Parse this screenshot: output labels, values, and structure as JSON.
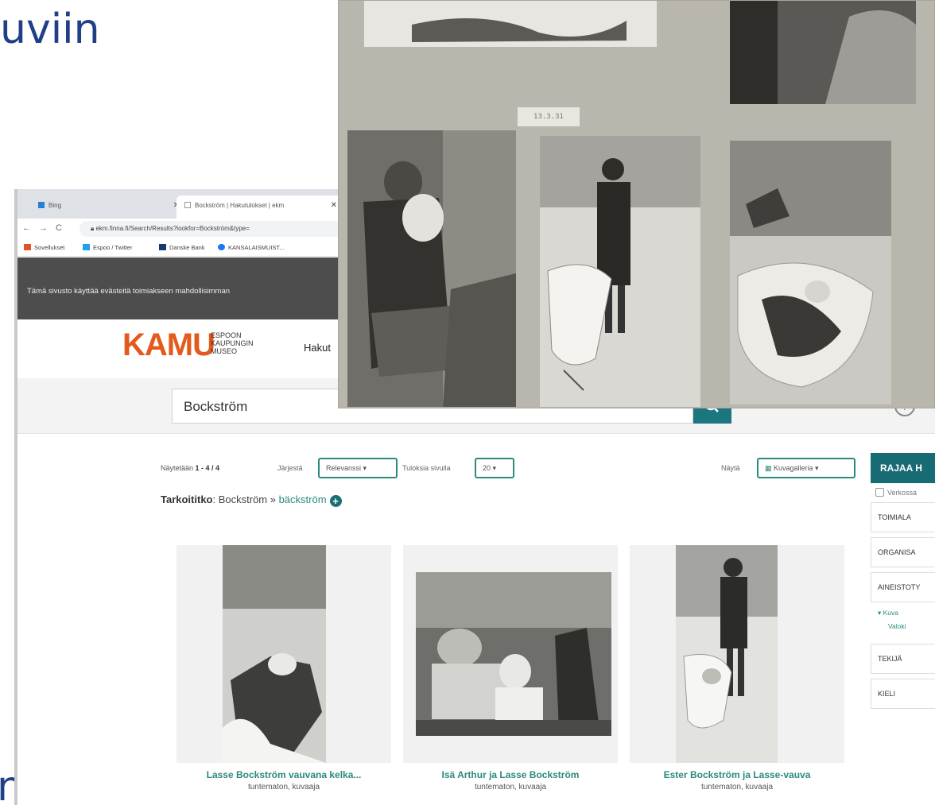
{
  "slide": {
    "title_fragment": "uviin",
    "bottom_fragment": "n"
  },
  "browser": {
    "tabs": [
      {
        "label": "Bing"
      },
      {
        "label": "Bockström | Hakutulokset | ekm"
      }
    ],
    "address": "ekm.finna.fi/Search/Results?lookfor=Bockström&type=",
    "bookmarks": [
      "Sovellukset",
      "Espoo / Twitter",
      "Danske Bank",
      "KANSALAISMUIST..."
    ],
    "cookie_notice": "Tämä sivusto käyttää evästeitä toimiakseen mahdollisimman"
  },
  "site": {
    "logo_word": "KAMU",
    "logo_sub": [
      "ESPOON",
      "KAUPUNGIN",
      "MUSEO"
    ],
    "nav_first": "Hakut",
    "search_value": "Bockström",
    "help": "?"
  },
  "results": {
    "showing_label": "Näytetään",
    "showing_range": "1 - 4 / 4",
    "sort_label": "Järjestä",
    "sort_value": "Relevanssi ▾",
    "per_page_label": "Tuloksia sivulla",
    "per_page_value": "20 ▾",
    "view_label": "Näytä",
    "view_value": "Kuvagalleria ▾",
    "did_you_mean_label": "Tarkoititko",
    "did_you_mean_query": ": Bockström » ",
    "did_you_mean_suggestion": "bäckström"
  },
  "facets": {
    "title": "RAJAA H",
    "online_checkbox": "Verkossa",
    "items": [
      "TOIMIALA",
      "ORGANISA",
      "AINEISTOTY",
      "TEKIJÄ",
      "KIELI"
    ],
    "sub_kuva": "▾ Kuva",
    "sub_valok": "Valoki"
  },
  "cards": [
    {
      "title": "Lasse Bockström vauvana kelka...",
      "author": "tuntematon, kuvaaja"
    },
    {
      "title": "Isä Arthur ja Lasse Bockström",
      "author": "tuntematon, kuvaaja"
    },
    {
      "title": "Ester Bockström ja Lasse-vauva",
      "author": "tuntematon, kuvaaja"
    }
  ],
  "album": {
    "date_label": "13.3.31"
  },
  "colors": {
    "accent": "#1b7680",
    "link": "#2a8a7e",
    "logo": "#e35a1c",
    "slide_text": "#1f3f86"
  }
}
